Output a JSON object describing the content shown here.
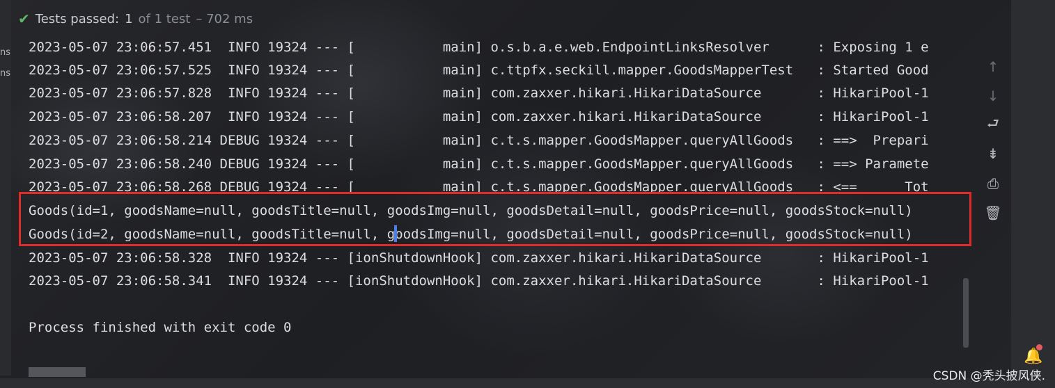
{
  "left_strip": {
    "texts": [
      "ns",
      "ns"
    ]
  },
  "status": {
    "passed_label": "Tests passed:",
    "count": "1",
    "of_text": "of 1 test",
    "duration": "– 702 ms"
  },
  "console": {
    "lines": [
      "2023-05-07 23:06:57.451  INFO 19324 --- [           main] o.s.b.a.e.web.EndpointLinksResolver      : Exposing 1 e",
      "2023-05-07 23:06:57.525  INFO 19324 --- [           main] c.ttpfx.seckill.mapper.GoodsMapperTest   : Started Good",
      "2023-05-07 23:06:57.828  INFO 19324 --- [           main] com.zaxxer.hikari.HikariDataSource       : HikariPool-1",
      "2023-05-07 23:06:58.207  INFO 19324 --- [           main] com.zaxxer.hikari.HikariDataSource       : HikariPool-1",
      "2023-05-07 23:06:58.214 DEBUG 19324 --- [           main] c.t.s.mapper.GoodsMapper.queryAllGoods   : ==>  Prepari",
      "2023-05-07 23:06:58.240 DEBUG 19324 --- [           main] c.t.s.mapper.GoodsMapper.queryAllGoods   : ==> Paramete",
      "2023-05-07 23:06:58.268 DEBUG 19324 --- [           main] c.t.s.mapper.GoodsMapper.queryAllGoods   : <==      Tot",
      "Goods(id=1, goodsName=null, goodsTitle=null, goodsImg=null, goodsDetail=null, goodsPrice=null, goodsStock=null)",
      "Goods(id=2, goodsName=null, goodsTitle=null, goodsImg=null, goodsDetail=null, goodsPrice=null, goodsStock=null)",
      "2023-05-07 23:06:58.328  INFO 19324 --- [ionShutdownHook] com.zaxxer.hikari.HikariDataSource       : HikariPool-1",
      "2023-05-07 23:06:58.341  INFO 19324 --- [ionShutdownHook] com.zaxxer.hikari.HikariDataSource       : HikariPool-1",
      "",
      "Process finished with exit code 0"
    ]
  },
  "toolbar": {
    "up_icon": "↑",
    "down_icon": "↓",
    "wrap_icon": "⮐",
    "scroll_end_icon": "⇟",
    "print_icon": "⎙",
    "trash_icon": "🗑"
  },
  "notifications": {
    "bell_icon": "🔔"
  },
  "watermark": "CSDN @秃头披风侠.",
  "colors": {
    "success": "#5fb865",
    "highlight": "#e02b2b",
    "cursor": "#4c7ee8"
  }
}
